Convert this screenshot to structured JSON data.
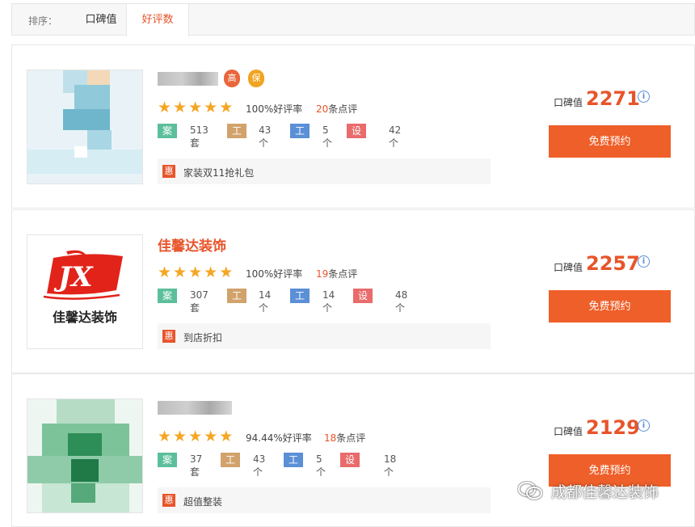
{
  "sortbar": {
    "label": "排序：",
    "koubei": "口碑值",
    "haoping": "好评数"
  },
  "cards": [
    {
      "name": "",
      "badges": [
        "高",
        "保"
      ],
      "stars": 5,
      "rate": "100%好评率",
      "reviews_num": "20",
      "reviews_suffix": "条点评",
      "tags": {
        "case": "案例",
        "case_val": "513套",
        "site": "工地",
        "site_val": "43个",
        "foreman": "工长",
        "foreman_val": "5个",
        "designer": "设计师",
        "designer_val": "42个"
      },
      "promo_icon": "惠",
      "promo": "家装双11抢礼包",
      "koubei_label": "口碑值",
      "koubei": "2271",
      "button": "免费预约"
    },
    {
      "name": "佳馨达装饰",
      "logo_text": "佳馨达装饰",
      "stars": 5,
      "rate": "100%好评率",
      "reviews_num": "19",
      "reviews_suffix": "条点评",
      "tags": {
        "case": "案例",
        "case_val": "307套",
        "site": "工地",
        "site_val": "14个",
        "foreman": "工长",
        "foreman_val": "14个",
        "designer": "设计师",
        "designer_val": "48个"
      },
      "promo_icon": "惠",
      "promo": "到店折扣",
      "koubei_label": "口碑值",
      "koubei": "2257",
      "button": "免费预约"
    },
    {
      "name": "",
      "stars": 5,
      "rate": "94.44%好评率",
      "reviews_num": "18",
      "reviews_suffix": "条点评",
      "tags": {
        "case": "案例",
        "case_val": "37套",
        "site": "工地",
        "site_val": "43个",
        "foreman": "工长",
        "foreman_val": "5个",
        "designer": "设计师",
        "designer_val": "18个"
      },
      "promo_icon": "惠",
      "promo": "超值整装",
      "koubei_label": "口碑值",
      "koubei": "2129",
      "button": "免费预约"
    }
  ],
  "watermark": "成都佳馨达装饰",
  "colors": {
    "accent": "#e8542a",
    "button": "#ef5f29",
    "star": "#f5a623",
    "tag_case": "#5bbf9b",
    "tag_site": "#d2a26c",
    "tag_foreman": "#5b8fd6",
    "tag_designer": "#e96b6b"
  }
}
